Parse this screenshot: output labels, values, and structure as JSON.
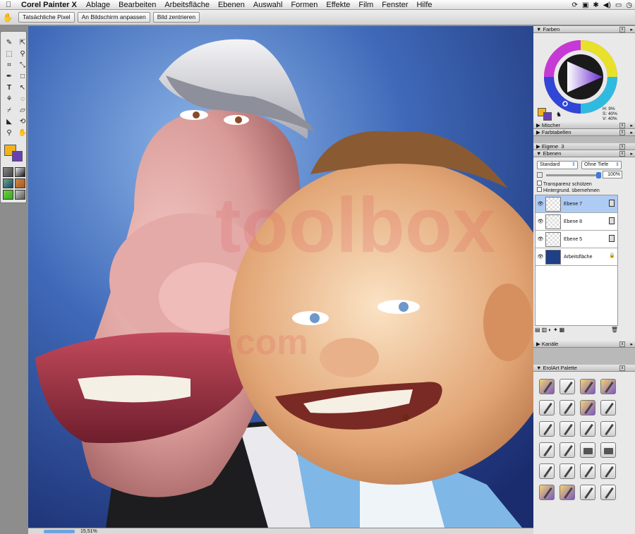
{
  "menubar": {
    "apple": "",
    "app_name": "Corel Painter X",
    "items": [
      "Ablage",
      "Bearbeiten",
      "Arbeitsfläche",
      "Ebenen",
      "Auswahl",
      "Formen",
      "Effekte",
      "Film",
      "Fenster",
      "Hilfe"
    ]
  },
  "toolbar": {
    "buttons": [
      "Tatsächliche Pixel",
      "An Bildschirm anpassen",
      "Bild zentrieren"
    ]
  },
  "toolbox": {
    "main_color": "#f2b21a",
    "additional_color": "#6a3fb4",
    "tools": [
      "brush-tool",
      "layer-adjuster-tool",
      "rect-select-tool",
      "magic-wand-tool",
      "crop-tool",
      "transform-tool",
      "pen-tool",
      "rect-shape-tool",
      "text-tool",
      "shape-select-tool",
      "magnifier-eyedropper-tool",
      "grabber-tool",
      "dropper-tool",
      "eraser-tool",
      "paint-bucket-tool",
      "rotate-page-tool",
      "magnifier-tool",
      "hand-tool"
    ]
  },
  "status": {
    "zoom": "15,51%"
  },
  "panels": {
    "farben": {
      "title": "Farben",
      "hsv": [
        "H: 9%",
        "S: 40%",
        "V: 40%"
      ]
    },
    "mischer": {
      "title": "Mischer"
    },
    "farbtabellen": {
      "title": "Farbtabellen"
    },
    "eigene": {
      "title": "Eigene",
      "count": "3"
    },
    "ebenen": {
      "title": "Ebenen",
      "composite": "Standard",
      "depth": "Ohne Tiefe",
      "opacity": "100%",
      "checkbox1": "Transparenz schützen",
      "checkbox2": "Hintergrund. übernehmen",
      "layers": [
        {
          "name": "Ebene 7",
          "selected": true
        },
        {
          "name": "Ebene 8",
          "selected": false
        },
        {
          "name": "Ebene 5",
          "selected": false
        },
        {
          "name": "Arbeitsfläche",
          "selected": false
        }
      ]
    },
    "kanaele": {
      "title": "Kanäle"
    },
    "erolart": {
      "title": "ErolArt Palette"
    }
  },
  "watermark": {
    "text": "toolbox",
    "subtext": ".com"
  }
}
